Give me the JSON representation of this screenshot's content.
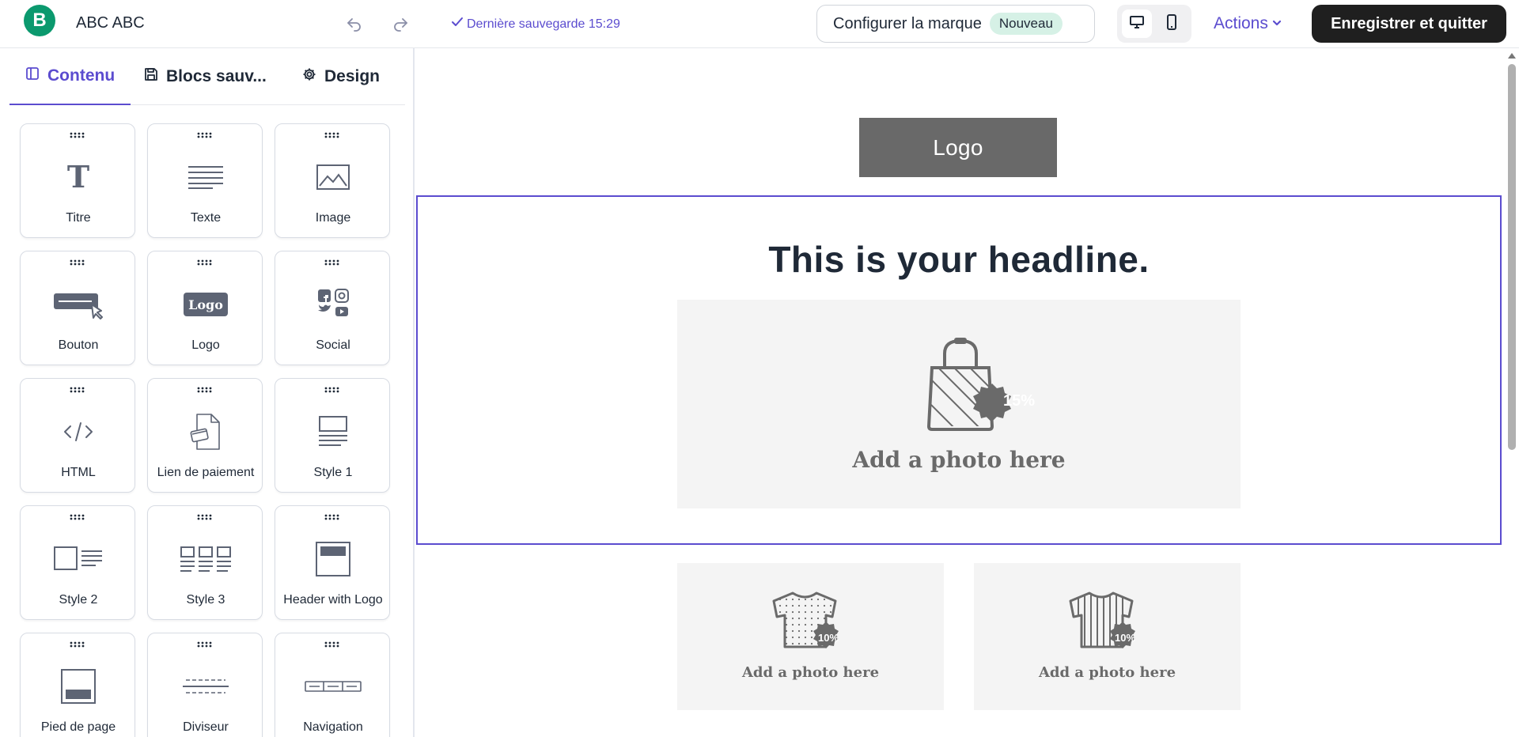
{
  "header": {
    "brand_letter": "B",
    "doc_title": "ABC ABC",
    "saved_label": "Dernière sauvegarde 15:29",
    "brand_config_label": "Configurer la marque",
    "brand_config_badge": "Nouveau",
    "actions_label": "Actions",
    "save_quit_label": "Enregistrer et quitter"
  },
  "sidebar": {
    "tabs": [
      {
        "label": "Contenu",
        "icon": "layout-panel-icon",
        "active": true
      },
      {
        "label": "Blocs sauv...",
        "icon": "save-icon",
        "active": false
      },
      {
        "label": "Design",
        "icon": "gear-icon",
        "active": false
      }
    ],
    "blocks": [
      {
        "label": "Titre",
        "icon": "title-icon"
      },
      {
        "label": "Texte",
        "icon": "text-icon"
      },
      {
        "label": "Image",
        "icon": "image-icon"
      },
      {
        "label": "Bouton",
        "icon": "button-icon"
      },
      {
        "label": "Logo",
        "icon": "logo-icon",
        "icon_text": "Logo"
      },
      {
        "label": "Social",
        "icon": "social-icon"
      },
      {
        "label": "HTML",
        "icon": "code-icon"
      },
      {
        "label": "Lien de paiement",
        "icon": "payment-link-icon"
      },
      {
        "label": "Style 1",
        "icon": "style-1-icon"
      },
      {
        "label": "Style 2",
        "icon": "style-2-icon"
      },
      {
        "label": "Style 3",
        "icon": "style-3-icon"
      },
      {
        "label": "Header with Logo",
        "icon": "header-logo-icon"
      },
      {
        "label": "Pied de page",
        "icon": "footer-icon"
      },
      {
        "label": "Diviseur",
        "icon": "divider-icon"
      },
      {
        "label": "Navigation",
        "icon": "navigation-icon"
      }
    ]
  },
  "canvas": {
    "logo_text": "Logo",
    "headline": "This is your headline.",
    "hero_photo": {
      "caption": "Add a photo here",
      "discount": "15%"
    },
    "small_photos": [
      {
        "caption": "Add a photo here",
        "discount": "10%"
      },
      {
        "caption": "Add a photo here",
        "discount": "10%"
      }
    ]
  },
  "colors": {
    "accent": "#5b4ccf",
    "brand_green": "#0b996e",
    "dark_button": "#1f1f1f",
    "placeholder_bg": "#f4f4f4",
    "logo_block_bg": "#696969"
  }
}
